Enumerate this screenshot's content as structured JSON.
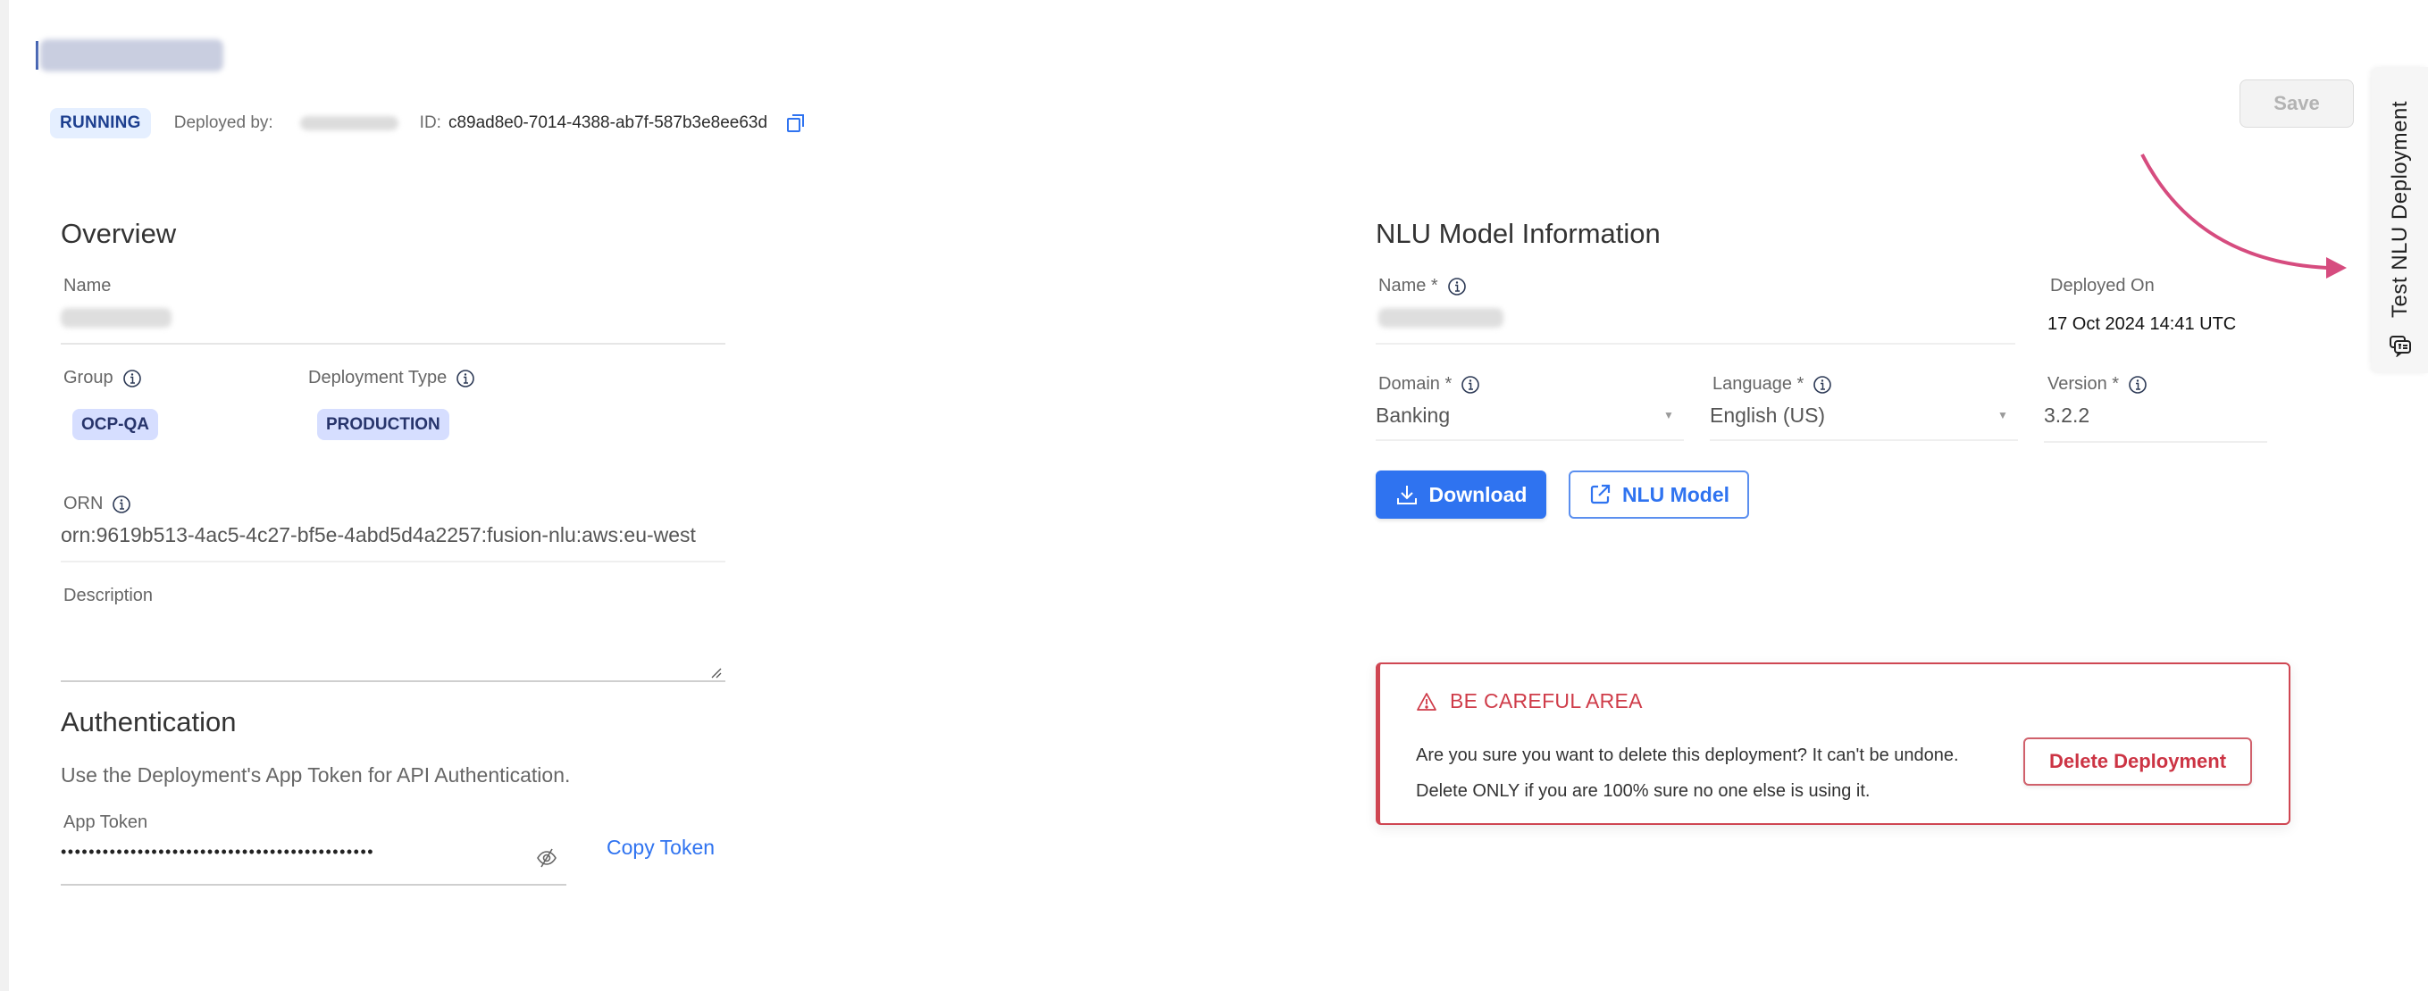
{
  "header": {
    "title": "",
    "status_badge": "RUNNING",
    "deployed_by_label": "Deployed by:",
    "deployed_by_value": "",
    "id_label": "ID:",
    "id_value": "c89ad8e0-7014-4388-ab7f-587b3e8ee63d",
    "copy_icon": "copy-icon",
    "save_label": "Save"
  },
  "side_tab": {
    "label": "Test NLU Deployment",
    "icon": "chat-icon"
  },
  "overview": {
    "title": "Overview",
    "name_label": "Name",
    "name_value": "",
    "group_label": "Group",
    "group_value": "OCP-QA",
    "deployment_type_label": "Deployment Type",
    "deployment_type_value": "PRODUCTION",
    "orn_label": "ORN",
    "orn_value": "orn:9619b513-4ac5-4c27-bf5e-4abd5d4a2257:fusion-nlu:aws:eu-west",
    "description_label": "Description",
    "description_value": ""
  },
  "authentication": {
    "title": "Authentication",
    "description": "Use the Deployment's App Token for API Authentication.",
    "app_token_label": "App Token",
    "app_token_masked": "•••••••••••••••••••••••••••••••••••••••••••••",
    "copy_token_label": "Copy Token"
  },
  "nlu_model": {
    "title": "NLU Model Information",
    "name_label": "Name *",
    "name_value": "",
    "deployed_on_label": "Deployed On",
    "deployed_on_value": "17 Oct 2024 14:41 UTC",
    "domain_label": "Domain *",
    "domain_value": "Banking",
    "language_label": "Language *",
    "language_value": "English (US)",
    "version_label": "Version *",
    "version_value": "3.2.2",
    "download_label": "Download",
    "nlu_model_label": "NLU Model"
  },
  "danger_zone": {
    "title": "BE CAREFUL AREA",
    "message": "Are you sure you want to delete this deployment? It can't be undone. Delete ONLY if you are 100% sure no one else is using it.",
    "delete_label": "Delete Deployment"
  },
  "colors": {
    "accent": "#2f73f0",
    "danger": "#cf4652",
    "running_bg": "#e5efff",
    "chip_bg": "#d6deff",
    "annotation_arrow": "#d64c7f"
  }
}
